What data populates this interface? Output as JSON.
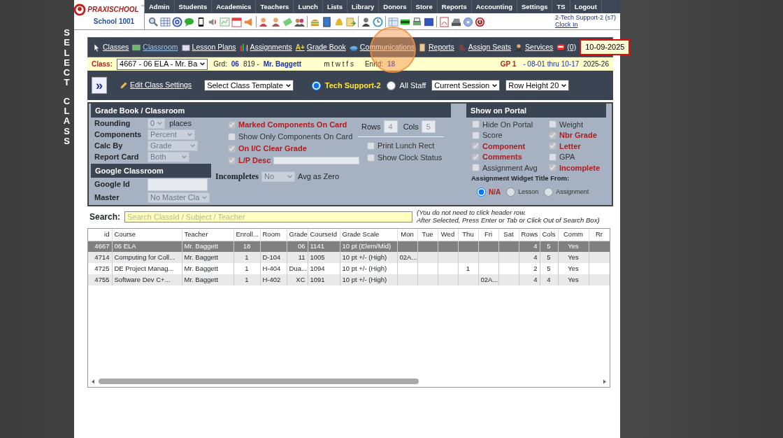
{
  "side_labels": [
    "SELECT",
    "CLASS"
  ],
  "logo": {
    "brand": "PRAXISCHOOL",
    "tm": "™",
    "school": "School 1001"
  },
  "menu": [
    "Admin",
    "Students",
    "Academics",
    "Teachers",
    "Lunch",
    "Lists",
    "Library",
    "Donors",
    "Store",
    "Reports",
    "Accounting",
    "Settings",
    "TS",
    "Logout"
  ],
  "user": {
    "name": "2-Tech Support-2 (s7)",
    "link": "Clock In"
  },
  "nav_links": [
    {
      "label": "Classes",
      "selected": false
    },
    {
      "label": "Classroom",
      "selected": true
    },
    {
      "label": "Lesson Plans",
      "selected": false
    },
    {
      "label": "Assignments",
      "selected": false
    },
    {
      "label": "Grade Book",
      "icon_text": "A+",
      "selected": false
    },
    {
      "label": "Communications",
      "selected": false
    },
    {
      "label": "Reports",
      "selected": false
    },
    {
      "label": "Assign Seats",
      "selected": false
    },
    {
      "label": "Services",
      "selected": false
    },
    {
      "label": "(0)",
      "selected": false
    }
  ],
  "date": "10-09-2025",
  "class_bar": {
    "label": "Class:",
    "class_select": "4667 - 06 ELA - Mr. Ba",
    "grd_label": "Grd:",
    "grd": "06",
    "teacher_id": "819 -",
    "teacher": "Mr. Baggett",
    "days": "m t w t f s",
    "enrld_label": "Enrld:",
    "enrld": "18",
    "gp": "GP 1",
    "range": "- 08-01 thru 10-17",
    "year": "2025-26"
  },
  "toolbar": {
    "expand": "»",
    "edit": "Edit Class Settings",
    "template": "Select Class Template",
    "staff": [
      {
        "label": "Tech Support-2",
        "selected": true
      },
      {
        "label": "All Staff",
        "selected": false
      }
    ],
    "session": "Current Session",
    "row_height": "Row Height 20"
  },
  "gradebook": {
    "title": "Grade Book / Classroom",
    "fields": [
      {
        "label": "Rounding",
        "value": "0",
        "suffix": "places"
      },
      {
        "label": "Components",
        "value": "Percent"
      },
      {
        "label": "Calc By",
        "value": "Grade"
      },
      {
        "label": "Report Card",
        "value": "Both"
      }
    ],
    "google_title": "Google Classroom",
    "google_fields": [
      {
        "label": "Google Id",
        "kind": "input"
      },
      {
        "label": "Master",
        "kind": "select",
        "value": "No Master Cla"
      }
    ],
    "options": [
      {
        "label": "Marked Components On Card",
        "checked": true
      },
      {
        "label": "Show Only Components On Card",
        "checked": false
      },
      {
        "label": "On I/C Clear Grade",
        "checked": true
      },
      {
        "label": "L/P Desc",
        "checked": true,
        "kind": "input"
      }
    ],
    "incompletes": {
      "label": "Incompletes",
      "value": "No",
      "suffix": "Avg as Zero"
    },
    "rows_label": "Rows",
    "rows": "4",
    "cols_label": "Cols",
    "cols": "5",
    "extra_options": [
      {
        "label": "Print Lunch Rect",
        "checked": false
      },
      {
        "label": "Show Clock Status",
        "checked": false
      }
    ]
  },
  "portal": {
    "title": "Show on Portal",
    "options": [
      {
        "label": "Hide On Portal",
        "checked": false
      },
      {
        "label": "Weight",
        "checked": false
      },
      {
        "label": "Score",
        "checked": false
      },
      {
        "label": "Nbr Grade",
        "checked": true
      },
      {
        "label": "Component",
        "checked": true
      },
      {
        "label": "Letter",
        "checked": true
      },
      {
        "label": "Comments",
        "checked": true
      },
      {
        "label": "GPA",
        "checked": false
      },
      {
        "label": "Assignment Avg",
        "checked": false
      },
      {
        "label": "Incomplete",
        "checked": true
      }
    ],
    "widget_label": "Assignment Widget Title From:",
    "widget_options": [
      {
        "label": "N/A",
        "selected": true
      },
      {
        "label": "Lesson",
        "selected": false
      },
      {
        "label": "Assignment",
        "selected": false
      }
    ]
  },
  "search": {
    "label": "Search:",
    "placeholder": "Search ClassId / Subject / Teacher",
    "hint": [
      "(You do not need to click header row.",
      "After Selected, Press Enter or Tab or Click Out of Search Box)"
    ]
  },
  "table": {
    "columns": [
      "id",
      "Course",
      "Teacher",
      "Enroll...",
      "Room",
      "Grade",
      "CourseId",
      "Grade Scale",
      "Mon",
      "Tue",
      "Wed",
      "Thu",
      "Fri",
      "Sat",
      "Rows",
      "Cols",
      "Comm",
      "Rr"
    ],
    "rows": [
      {
        "selected": true,
        "cells": [
          "4667",
          "06 ELA",
          "Mr. Baggett",
          "18",
          "",
          "06",
          "1141",
          "10 pt (Elem/Mid)",
          "",
          "",
          "",
          "",
          "",
          "",
          "4",
          "5",
          "Yes",
          ""
        ]
      },
      {
        "selected": false,
        "cells": [
          "4714",
          "Computing for Coll...",
          "Mr. Baggett",
          "1",
          "D-104",
          "11",
          "1005",
          "10 pt +/- (High)",
          "02A...",
          "",
          "",
          "",
          "",
          "",
          "4",
          "5",
          "Yes",
          ""
        ]
      },
      {
        "selected": false,
        "cells": [
          "4725",
          "DE Project Manag...",
          "Mr. Baggett",
          "1",
          "H-404",
          "Dua...",
          "1094",
          "10 pt +/- (High)",
          "",
          "",
          "",
          "1",
          "",
          "",
          "2",
          "5",
          "Yes",
          ""
        ]
      },
      {
        "selected": false,
        "cells": [
          "4755",
          "Software Dev C+...",
          "Mr. Baggett",
          "1",
          "H-402",
          "XC",
          "1091",
          "10 pt +/- (High)",
          "",
          "",
          "",
          "",
          "02A...",
          "",
          "4",
          "4",
          "Yes",
          ""
        ]
      }
    ]
  }
}
